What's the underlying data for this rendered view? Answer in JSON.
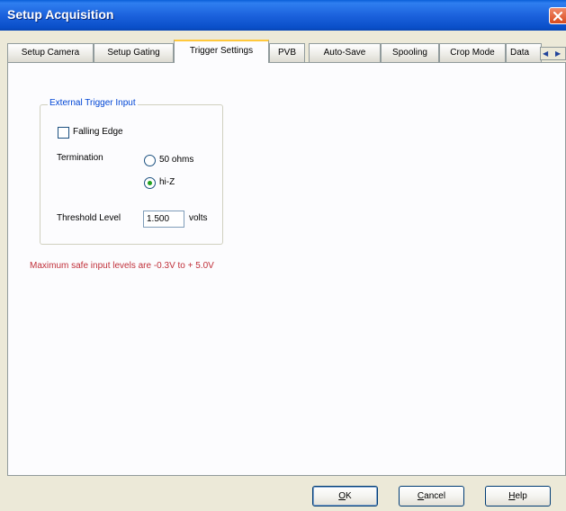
{
  "window": {
    "title": "Setup Acquisition"
  },
  "tabs": [
    {
      "label": "Setup Camera"
    },
    {
      "label": "Setup Gating"
    },
    {
      "label": "Trigger Settings",
      "active": true
    },
    {
      "label": "PVB"
    },
    {
      "label": "Auto-Save"
    },
    {
      "label": "Spooling"
    },
    {
      "label": "Crop Mode"
    },
    {
      "label": "Data"
    }
  ],
  "trigger": {
    "group_title": "External Trigger Input",
    "falling_edge_label": "Falling Edge",
    "falling_edge_checked": false,
    "termination_label": "Termination",
    "termination_options": [
      "50 ohms",
      "hi-Z"
    ],
    "termination_selected": "hi-Z",
    "threshold_label": "Threshold Level",
    "threshold_value": "1.500",
    "threshold_unit": "volts"
  },
  "warning_text": "Maximum safe input levels are -0.3V to + 5.0V",
  "buttons": {
    "ok_mnemonic": "O",
    "ok_rest": "K",
    "cancel_mnemonic": "C",
    "cancel_rest": "ancel",
    "help_mnemonic": "H",
    "help_rest": "elp"
  },
  "icons": {
    "close": "close-icon",
    "scroll_left": "scroll-left-icon",
    "scroll_right": "scroll-right-icon"
  },
  "colors": {
    "titlebar": "#0a4fc9",
    "group_title": "#0046d5",
    "warning": "#c0303a",
    "radio_dot": "#21a121",
    "active_tab_accent": "#ffc83c"
  }
}
